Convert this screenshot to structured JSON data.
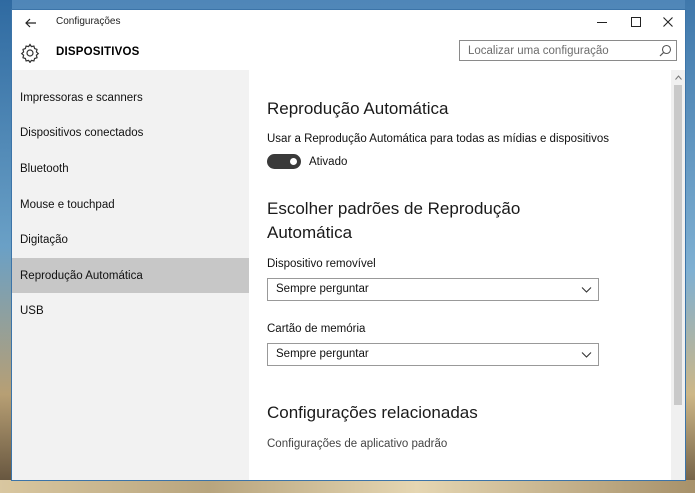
{
  "window": {
    "title": "Configurações",
    "controls": {
      "minimize": "minimize-icon",
      "maximize": "maximize-icon",
      "close": "close-icon"
    }
  },
  "header": {
    "title": "DISPOSITIVOS",
    "icon": "gear-icon"
  },
  "search": {
    "placeholder": "Localizar uma configuração",
    "value": ""
  },
  "sidebar": {
    "items": [
      {
        "label": "Impressoras e scanners",
        "selected": false
      },
      {
        "label": "Dispositivos conectados",
        "selected": false
      },
      {
        "label": "Bluetooth",
        "selected": false
      },
      {
        "label": "Mouse e touchpad",
        "selected": false
      },
      {
        "label": "Digitação",
        "selected": false
      },
      {
        "label": "Reprodução Automática",
        "selected": true
      },
      {
        "label": "USB",
        "selected": false
      }
    ]
  },
  "main": {
    "autoplay": {
      "title": "Reprodução Automática",
      "description": "Usar a Reprodução Automática para todas as mídias e dispositivos",
      "toggle_state": "Ativado",
      "toggle_on": true
    },
    "defaults": {
      "title_line1": "Escolher padrões de Reprodução",
      "title_line2": "Automática",
      "removable": {
        "label": "Dispositivo removível",
        "value": "Sempre perguntar"
      },
      "memory_card": {
        "label": "Cartão de memória",
        "value": "Sempre perguntar"
      }
    },
    "related": {
      "title": "Configurações relacionadas",
      "link": "Configurações de aplicativo padrão"
    }
  },
  "colors": {
    "sidebar_bg": "#f2f2f2",
    "selected_bg": "#c7c7c7",
    "toggle_on": "#3a3a3a"
  }
}
